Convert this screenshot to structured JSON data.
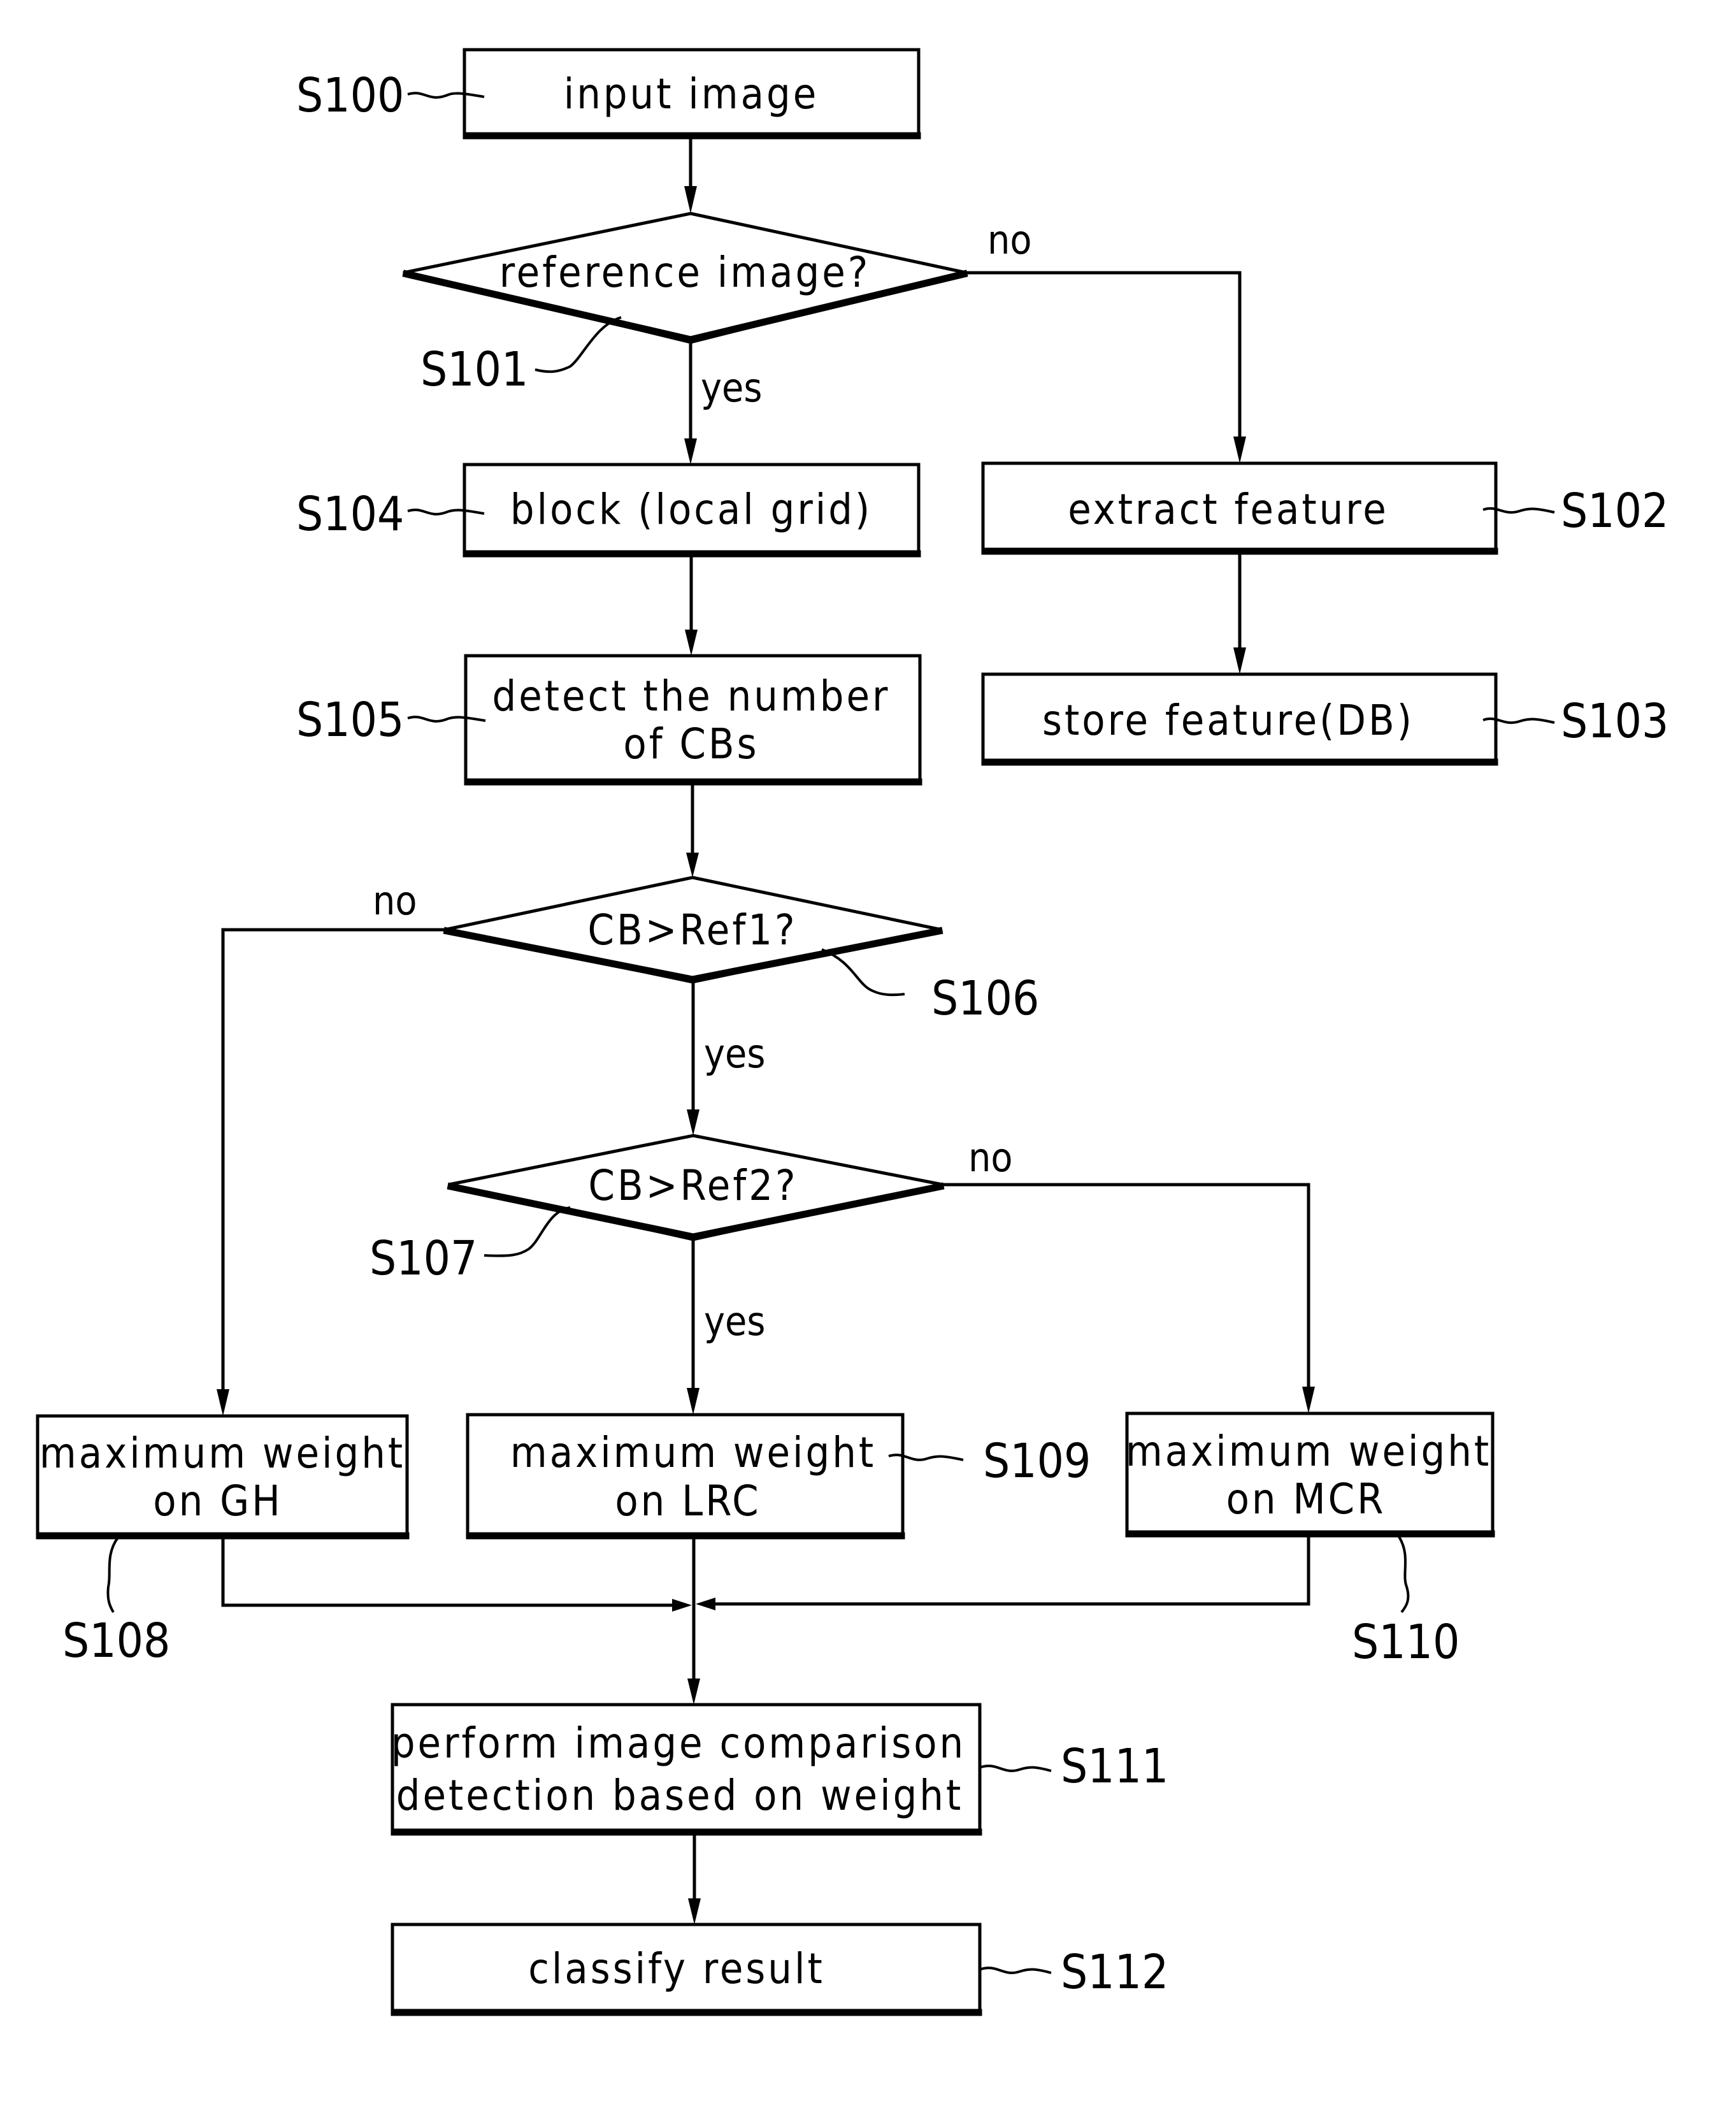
{
  "diagram": {
    "type": "flowchart",
    "steps": {
      "S100": {
        "id": "S100",
        "text": [
          "input image"
        ]
      },
      "S101": {
        "id": "S101",
        "text": [
          "reference image?"
        ]
      },
      "S102": {
        "id": "S102",
        "text": [
          "extract feature"
        ]
      },
      "S103": {
        "id": "S103",
        "text": [
          "store feature(DB)"
        ]
      },
      "S104": {
        "id": "S104",
        "text": [
          "block (local grid)"
        ]
      },
      "S105": {
        "id": "S105",
        "text": [
          "detect the number",
          "of CBs"
        ]
      },
      "S106": {
        "id": "S106",
        "text": [
          "CB>Ref1?"
        ]
      },
      "S107": {
        "id": "S107",
        "text": [
          "CB>Ref2?"
        ]
      },
      "S108": {
        "id": "S108",
        "text": [
          "maximum weight",
          "on GH"
        ]
      },
      "S109": {
        "id": "S109",
        "text": [
          "maximum weight",
          "on LRC"
        ]
      },
      "S110": {
        "id": "S110",
        "text": [
          "maximum weight",
          "on MCR"
        ]
      },
      "S111": {
        "id": "S111",
        "text": [
          "perform image comparison",
          "detection based on weight"
        ]
      },
      "S112": {
        "id": "S112",
        "text": [
          "classify result"
        ]
      }
    },
    "edge_labels": {
      "s101_no": "no",
      "s101_yes": "yes",
      "s106_no": "no",
      "s106_yes": "yes",
      "s107_no": "no",
      "s107_yes": "yes"
    },
    "edges": [
      {
        "from": "S100",
        "to": "S101"
      },
      {
        "from": "S101",
        "to": "S104",
        "label": "yes"
      },
      {
        "from": "S101",
        "to": "S102",
        "label": "no"
      },
      {
        "from": "S102",
        "to": "S103"
      },
      {
        "from": "S104",
        "to": "S105"
      },
      {
        "from": "S105",
        "to": "S106"
      },
      {
        "from": "S106",
        "to": "S107",
        "label": "yes"
      },
      {
        "from": "S106",
        "to": "S108",
        "label": "no"
      },
      {
        "from": "S107",
        "to": "S109",
        "label": "yes"
      },
      {
        "from": "S107",
        "to": "S110",
        "label": "no"
      },
      {
        "from": "S108",
        "to": "S111"
      },
      {
        "from": "S109",
        "to": "S111"
      },
      {
        "from": "S110",
        "to": "S111"
      },
      {
        "from": "S111",
        "to": "S112"
      }
    ]
  }
}
